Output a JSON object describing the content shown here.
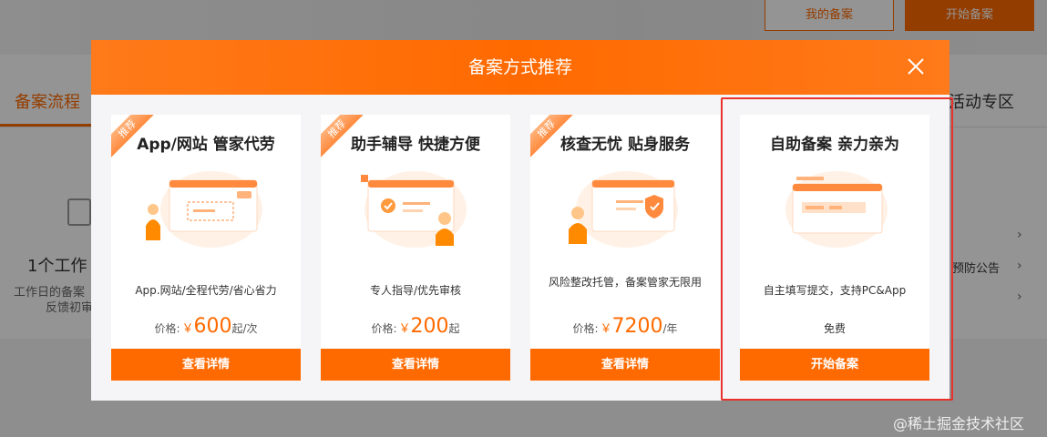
{
  "background": {
    "my_filing_label": "我的备案",
    "start_filing_label": "开始备案",
    "tab_left_label": "备案流程",
    "tab_right_label": "活动专区",
    "step_title": "1个工作",
    "step_desc_line1": "工作日的备案",
    "step_desc_line2": "反馈初审",
    "notice_text": "预防公告"
  },
  "modal": {
    "title": "备案方式推荐",
    "close_icon": "close-icon",
    "cards": [
      {
        "ribbon": "推荐",
        "title": "App/网站 管家代劳",
        "desc": "App.网站/全程代劳/省心省力",
        "price_label": "价格:",
        "price_currency": "￥",
        "price_amount": "600",
        "price_unit": "起/次",
        "button": "查看详情"
      },
      {
        "ribbon": "推荐",
        "title": "助手辅导 快捷方便",
        "desc": "专人指导/优先审核",
        "price_label": "价格:",
        "price_currency": "￥",
        "price_amount": "200",
        "price_unit": "起",
        "button": "查看详情"
      },
      {
        "ribbon": "推荐",
        "title": "核查无忧 贴身服务",
        "desc": "风险整改托管，备案管家无限用",
        "price_label": "价格:",
        "price_currency": "￥",
        "price_amount": "7200",
        "price_unit": "/年",
        "button": "查看详情"
      },
      {
        "title": "自助备案 亲力亲为",
        "desc": "自主填写提交，支持PC&App",
        "price_text": "免费",
        "button": "开始备案"
      }
    ]
  },
  "watermark": "@稀土掘金技术社区",
  "colors": {
    "accent": "#ff6a00",
    "highlight": "#e8322b"
  }
}
